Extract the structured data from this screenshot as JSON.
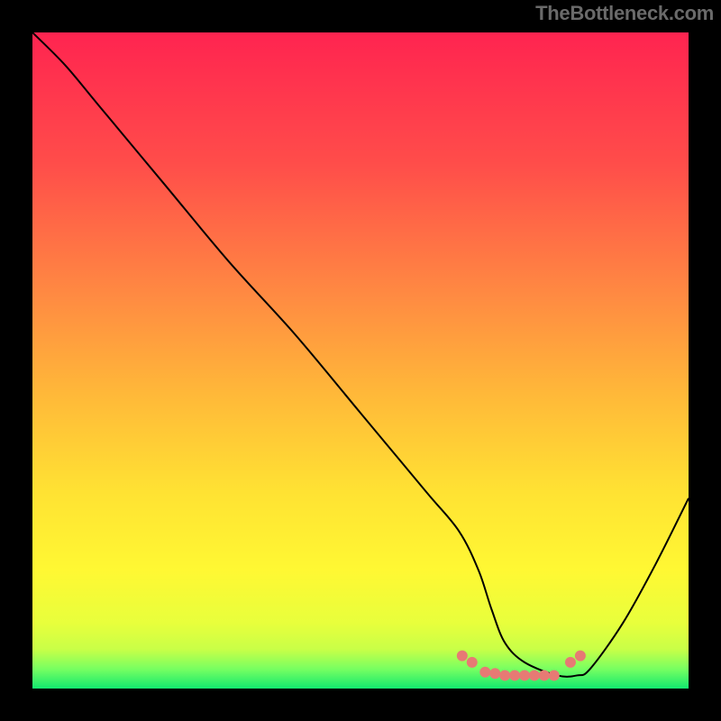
{
  "attribution": "TheBottleneck.com",
  "chart_data": {
    "type": "line",
    "title": "",
    "xlabel": "",
    "ylabel": "",
    "xlim": [
      0,
      100
    ],
    "ylim": [
      0,
      100
    ],
    "series": [
      {
        "name": "curve",
        "x": [
          0,
          5,
          10,
          20,
          30,
          40,
          50,
          60,
          65,
          68,
          70,
          72,
          75,
          80,
          83,
          85,
          90,
          95,
          100
        ],
        "y": [
          100,
          95,
          89,
          77,
          65,
          54,
          42,
          30,
          24,
          18,
          12,
          7,
          4,
          2,
          2,
          3,
          10,
          19,
          29
        ]
      }
    ],
    "dots": {
      "name": "sweet-spot",
      "color": "#e77a74",
      "points": [
        {
          "x": 65.5,
          "y": 5.0
        },
        {
          "x": 67.0,
          "y": 4.0
        },
        {
          "x": 69.0,
          "y": 2.5
        },
        {
          "x": 70.5,
          "y": 2.3
        },
        {
          "x": 72.0,
          "y": 2.0
        },
        {
          "x": 73.5,
          "y": 2.0
        },
        {
          "x": 75.0,
          "y": 2.0
        },
        {
          "x": 76.5,
          "y": 2.0
        },
        {
          "x": 78.0,
          "y": 2.0
        },
        {
          "x": 79.5,
          "y": 2.0
        },
        {
          "x": 82.0,
          "y": 4.0
        },
        {
          "x": 83.5,
          "y": 5.0
        }
      ]
    },
    "gradient_stops": [
      {
        "offset": 0.0,
        "color": "#ff2450"
      },
      {
        "offset": 0.2,
        "color": "#ff4d4a"
      },
      {
        "offset": 0.4,
        "color": "#ff8a42"
      },
      {
        "offset": 0.55,
        "color": "#ffb839"
      },
      {
        "offset": 0.7,
        "color": "#ffe233"
      },
      {
        "offset": 0.82,
        "color": "#fff833"
      },
      {
        "offset": 0.9,
        "color": "#e8ff3c"
      },
      {
        "offset": 0.94,
        "color": "#c9ff47"
      },
      {
        "offset": 0.97,
        "color": "#78ff61"
      },
      {
        "offset": 1.0,
        "color": "#12e96f"
      }
    ]
  }
}
